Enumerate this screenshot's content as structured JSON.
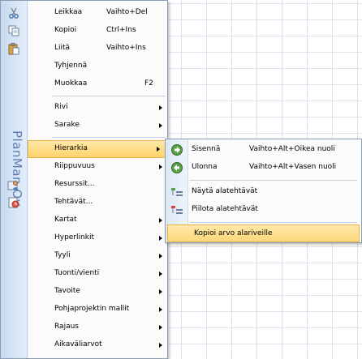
{
  "brand": "PlanMan Oy",
  "menu": {
    "items": [
      {
        "label": "Leikkaa",
        "shortcut": "Vaihto+Del",
        "icon": "scissors-icon"
      },
      {
        "label": "Kopioi",
        "shortcut": "Ctrl+Ins",
        "icon": "copy-icon"
      },
      {
        "label": "Liitä",
        "shortcut": "Vaihto+Ins",
        "icon": "paste-icon"
      },
      {
        "label": "Tyhjennä",
        "shortcut": ""
      },
      {
        "label": "Muokkaa",
        "shortcut": "F2"
      },
      {
        "label": "Rivi",
        "submenu": true
      },
      {
        "label": "Sarake",
        "submenu": true
      },
      {
        "label": "Hierarkia",
        "submenu": true,
        "highlighted": true
      },
      {
        "label": "Riippuvuus",
        "submenu": true
      },
      {
        "label": "Resurssit...",
        "icon": "resources-icon"
      },
      {
        "label": "Tehtävät...",
        "icon": "tasks-icon"
      },
      {
        "label": "Kartat",
        "submenu": true
      },
      {
        "label": "Hyperlinkit",
        "submenu": true
      },
      {
        "label": "Tyyli",
        "submenu": true
      },
      {
        "label": "Tuonti/vienti",
        "submenu": true
      },
      {
        "label": "Tavoite",
        "submenu": true
      },
      {
        "label": "Pohjaprojektin mallit",
        "submenu": true
      },
      {
        "label": "Rajaus",
        "submenu": true
      },
      {
        "label": "Aikaväliarvot",
        "submenu": true
      }
    ]
  },
  "submenu": {
    "items": [
      {
        "label": "Sisennä",
        "shortcut": "Vaihto+Alt+Oikea nuoli",
        "icon": "indent-icon"
      },
      {
        "label": "Ulonna",
        "shortcut": "Vaihto+Alt+Vasen nuoli",
        "icon": "outdent-icon"
      },
      {
        "label": "Näytä alatehtävät",
        "icon": "show-subtasks-icon"
      },
      {
        "label": "Piilota alatehtävät",
        "icon": "hide-subtasks-icon"
      },
      {
        "label": "Kopioi arvo alariveille",
        "highlighted": true
      }
    ]
  },
  "colors": {
    "highlight": "#ffd36b",
    "brand_text": "#5d7fae",
    "border": "#8a9db5"
  }
}
